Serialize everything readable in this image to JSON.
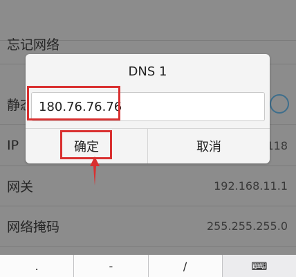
{
  "settings": {
    "forget_network": "忘记网络",
    "static_ip_partial": "静态",
    "ip_partial": "IP",
    "ip_value_partial": "118",
    "gateway_label": "网关",
    "gateway_value": "192.168.11.1",
    "netmask_label": "网络掩码",
    "netmask_value": "255.255.255.0"
  },
  "dialog": {
    "title": "DNS 1",
    "dns_value": "180.76.76.76",
    "ok_label": "确定",
    "cancel_label": "取消"
  },
  "keyboard": {
    "keys": [
      ".",
      "-",
      "/",
      "⌨"
    ]
  },
  "annotation": {
    "highlight_color": "#d93030"
  }
}
